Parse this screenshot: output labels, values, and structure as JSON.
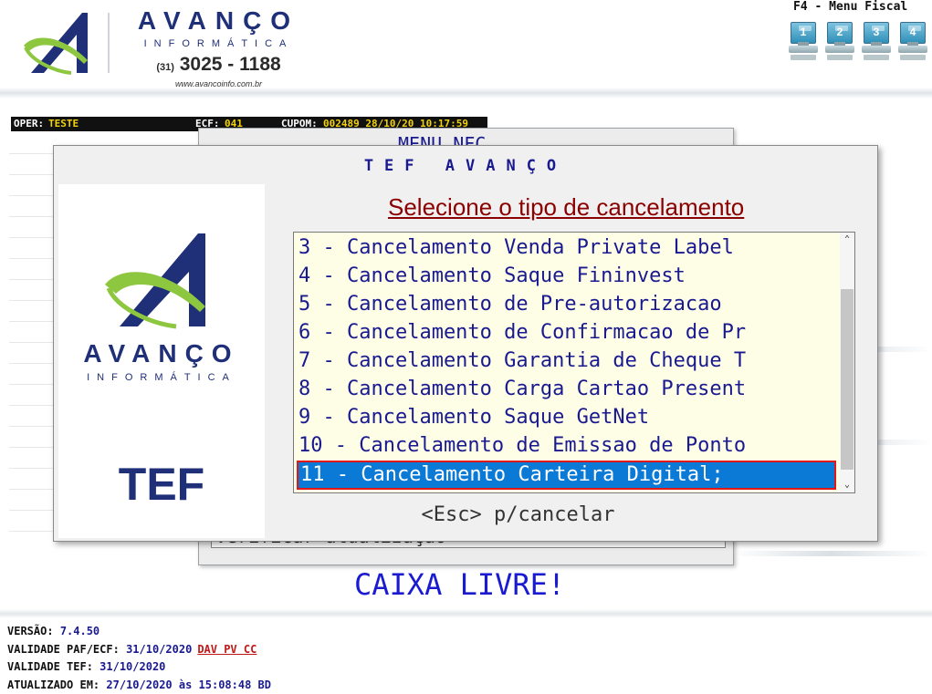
{
  "header": {
    "brand_name": "AVANÇO",
    "brand_sub": "INFORMÁTICA",
    "phone_prefix": "(31)",
    "phone": "3025 - 1188",
    "website": "www.avancoinfo.com.br",
    "fiscal_menu_title": "F4 - Menu Fiscal",
    "fiscal_buttons": [
      "1",
      "2",
      "3",
      "4"
    ]
  },
  "status_bar": {
    "oper_label": "OPER:",
    "oper_value": "TESTE",
    "ecf_label": "ECF:",
    "ecf_value": "041",
    "cupom_label": "CUPOM:",
    "cupom_value": "002489 28/10/20 10:17:59"
  },
  "background_menu": {
    "title": "MENU NFC",
    "bottom_text": "Verificar atualização"
  },
  "dialog": {
    "title": "TEF AVANÇO",
    "side_brand_name": "AVANÇO",
    "side_brand_sub": "INFORMÁTICA",
    "side_label": "TEF",
    "prompt": "Selecione o tipo de cancelamento",
    "items": [
      "3 - Cancelamento Venda Private Label",
      "4 - Cancelamento Saque Fininvest",
      "5 - Cancelamento de Pre-autorizacao",
      "6 - Cancelamento de Confirmacao de Pr",
      "7 - Cancelamento Garantia de Cheque T",
      "8 - Cancelamento Carga Cartao Present",
      "9 - Cancelamento Saque GetNet",
      "10 - Cancelamento de Emissao de Ponto",
      "11 - Cancelamento Carteira Digital;"
    ],
    "selected_index": 8,
    "cancel_hint": "<Esc> p/cancelar"
  },
  "caixa_status": "CAIXA LIVRE!",
  "footer": {
    "version_label": "VERSÃO:",
    "version_value": "7.4.50",
    "paf_label": "VALIDADE PAF/ECF:",
    "paf_value": "31/10/2020",
    "paf_flags": "DAV PV CC",
    "tef_label": "VALIDADE TEF:",
    "tef_value": "31/10/2020",
    "updated_label": "ATUALIZADO EM:",
    "updated_value": "27/10/2020 às 15:08:48 BD"
  },
  "colors": {
    "brand_blue": "#1f2f78",
    "brand_green": "#8dc63f",
    "list_text": "#1a1a90",
    "selected_bg": "#0a7ad6",
    "selected_border": "#e01818",
    "prompt": "#8b0000",
    "status_value": "#f2d20a"
  }
}
